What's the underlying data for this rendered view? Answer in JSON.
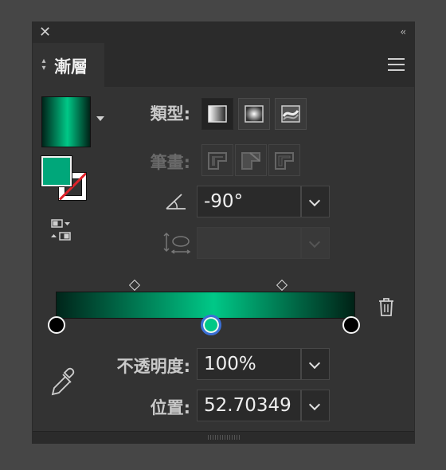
{
  "panel": {
    "close_glyph": "✕",
    "collapse_glyph": "‹‹",
    "tab_label": "漸層",
    "tab_arrows": "◇",
    "menu_icon": "hamburger-icon"
  },
  "controls": {
    "type_label": "類型:",
    "type_options": [
      "linear-gradient-icon",
      "radial-gradient-icon",
      "freeform-gradient-icon"
    ],
    "type_selected": 0,
    "stroke_label": "筆畫:",
    "stroke_options": [
      "stroke-within-icon",
      "stroke-along-icon",
      "stroke-across-icon"
    ],
    "angle_icon": "angle-icon",
    "angle_value": "-90°",
    "aspect_icon": "aspect-ratio-icon",
    "aspect_value": "",
    "opacity_label": "不透明度:",
    "opacity_value": "100%",
    "location_label": "位置:",
    "location_value": "52.70349"
  },
  "colors": {
    "stop_left": "#000000",
    "stop_mid": "#00c887",
    "stop_right": "#000000",
    "fill": "#00a77a",
    "stroke_none_slash": "#e0222a",
    "selected_ring": "#3b6fd6"
  },
  "gradient": {
    "stops": [
      {
        "position": 0,
        "color": "#00251a"
      },
      {
        "position": 52.7,
        "color": "#00c887"
      },
      {
        "position": 100,
        "color": "#002216"
      }
    ],
    "midpoints": [
      26,
      76
    ]
  },
  "icons": {
    "eyedropper": "eyedropper-icon",
    "trash": "trash-icon",
    "swap_fill_stroke": "swap-fill-stroke-icon"
  }
}
